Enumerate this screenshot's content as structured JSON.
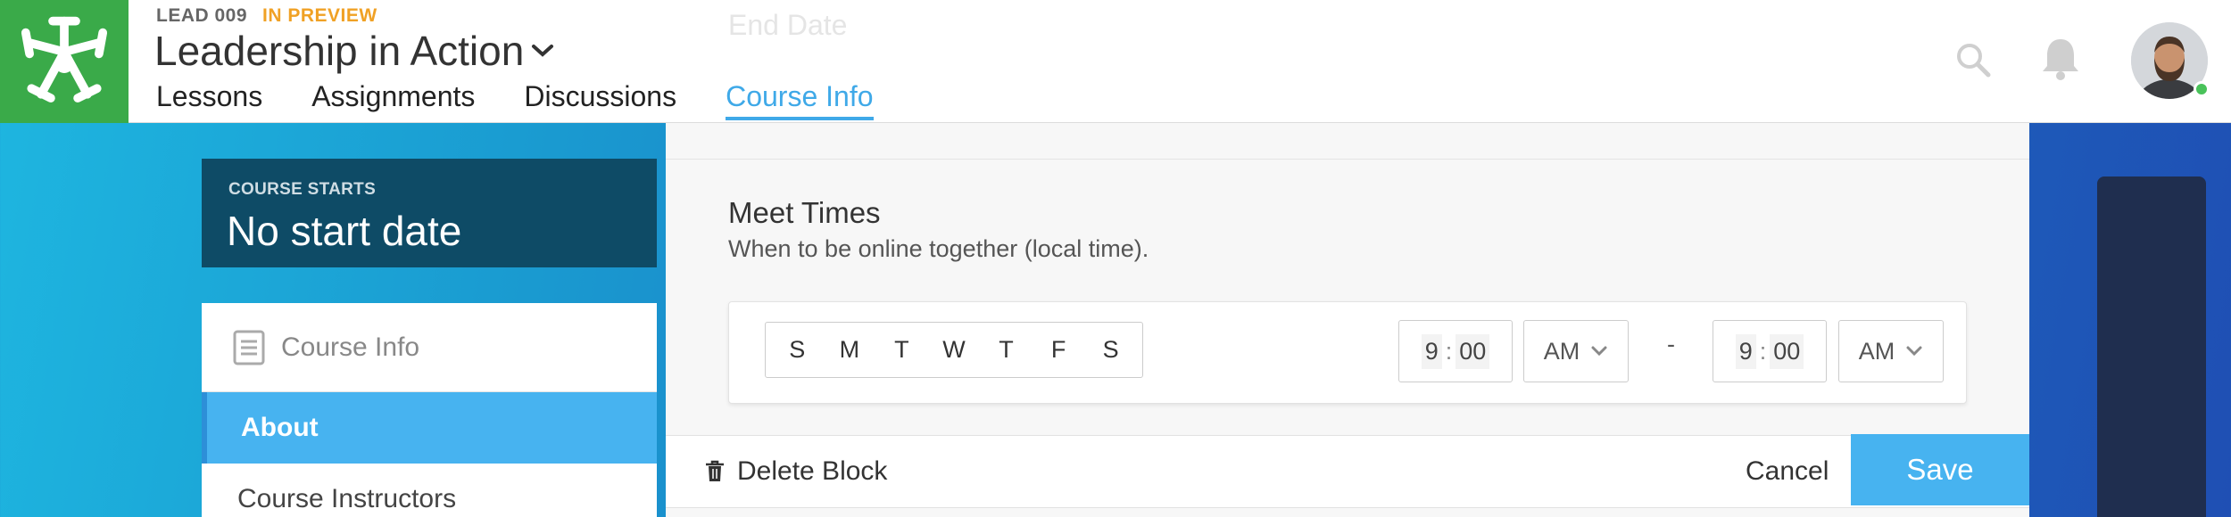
{
  "header": {
    "course_code": "LEAD 009",
    "status": "IN PREVIEW",
    "title": "Leadership in Action",
    "tabs": [
      {
        "label": "Lessons"
      },
      {
        "label": "Assignments"
      },
      {
        "label": "Discussions"
      },
      {
        "label": "Course Info",
        "active": true
      }
    ],
    "icons": {
      "search": "search-icon",
      "notifications": "bell-icon",
      "avatar": "user-avatar"
    },
    "online_color": "#49c25a",
    "accent_color": "#3fa9e8"
  },
  "sidebar": {
    "start_label": "COURSE STARTS",
    "start_value": "No start date",
    "nav_title": "Course Info",
    "items": [
      {
        "label": "About",
        "active": true
      },
      {
        "label": "Course Instructors"
      }
    ]
  },
  "editor": {
    "faded_label": "End Date",
    "meet_times_title": "Meet Times",
    "meet_times_desc": "When to be online together (local time).",
    "days": [
      "S",
      "M",
      "T",
      "W",
      "T",
      "F",
      "S"
    ],
    "start_time": {
      "hour": "9",
      "minute": "00",
      "period": "AM"
    },
    "separator": "-",
    "end_time": {
      "hour": "9",
      "minute": "00",
      "period": "AM"
    }
  },
  "footer": {
    "delete_label": "Delete Block",
    "cancel_label": "Cancel",
    "save_label": "Save",
    "save_color": "#47b3f0"
  }
}
